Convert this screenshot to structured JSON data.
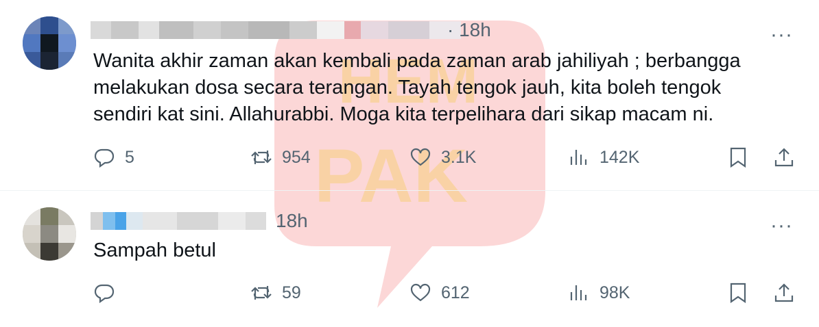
{
  "tweets": [
    {
      "time": "· 18h",
      "text_lines": [
        "Wanita akhir zaman akan kembali pada zaman arab jahiliyah ; berbangga",
        "melakukan dosa secara terangan. Tayah tengok jauh, kita boleh tengok",
        "sendiri kat sini. Allahurabbi. Moga kita terpelihara dari sikap macam ni."
      ],
      "more": "···",
      "replies": "5",
      "reposts": "954",
      "likes": "3.1K",
      "views": "142K"
    },
    {
      "time": "18h",
      "text_lines": [
        "Sampah betul"
      ],
      "more": "···",
      "replies": "",
      "reposts": "59",
      "likes": "612",
      "views": "98K"
    }
  ],
  "watermark": {
    "letters_1": "HEM",
    "letters_2": "PAK",
    "color": "#f04a4a"
  },
  "colors": {
    "text": "#0f1419",
    "muted": "#536471",
    "divider": "#eff3f4"
  },
  "icons": [
    "reply-icon",
    "repost-icon",
    "like-icon",
    "views-icon",
    "bookmark-icon",
    "share-icon",
    "more-icon"
  ]
}
